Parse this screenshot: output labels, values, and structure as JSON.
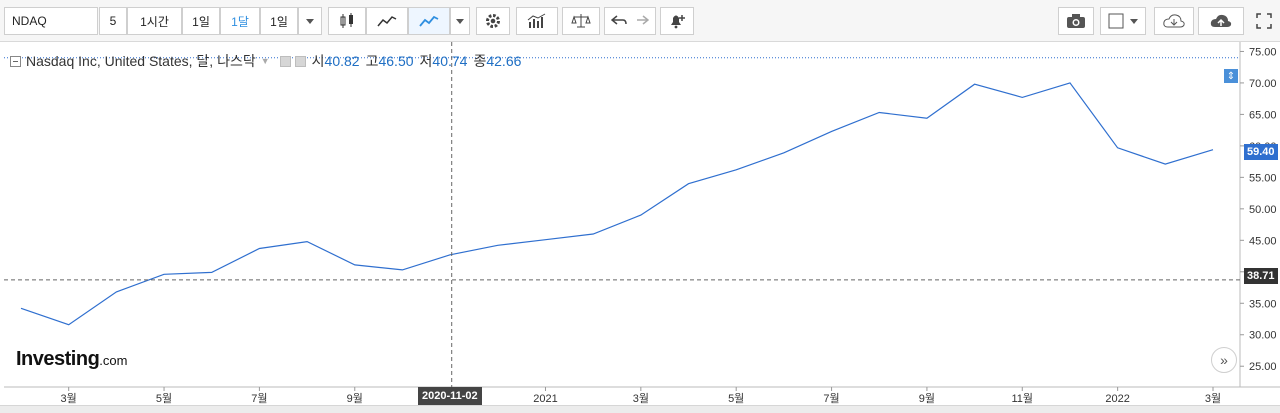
{
  "toolbar": {
    "symbol": "NDAQ",
    "intervals": [
      "5",
      "1시간",
      "1일",
      "1달",
      "1일"
    ],
    "active_interval": "1달"
  },
  "legend": {
    "title": "Nasdaq Inc, United States, 달, 나스닥",
    "open_label": "시",
    "open_value": "40.82",
    "high_label": "고",
    "high_value": "46.50",
    "low_label": "저",
    "low_value": "40.74",
    "close_label": "종",
    "close_value": "42.66"
  },
  "chart_data": {
    "type": "line",
    "x": [
      "2020-02",
      "2020-03",
      "2020-04",
      "2020-05",
      "2020-06",
      "2020-07",
      "2020-08",
      "2020-09",
      "2020-10",
      "2020-11",
      "2020-12",
      "2021-01",
      "2021-02",
      "2021-03",
      "2021-04",
      "2021-05",
      "2021-06",
      "2021-07",
      "2021-08",
      "2021-09",
      "2021-10",
      "2021-11",
      "2021-12",
      "2022-01",
      "2022-02",
      "2022-03"
    ],
    "series": [
      {
        "values": [
          34.2,
          31.6,
          36.8,
          39.6,
          39.9,
          43.7,
          44.8,
          41.1,
          40.3,
          42.7,
          44.2,
          45.1,
          46.0,
          49.0,
          54.0,
          56.2,
          58.9,
          62.3,
          65.3,
          64.4,
          69.8,
          67.7,
          70.0,
          59.7,
          57.1,
          59.4
        ]
      }
    ],
    "y_ticks": [
      "75.00",
      "70.00",
      "65.00",
      "60.00",
      "55.00",
      "50.00",
      "45.00",
      "40.00",
      "35.00",
      "30.00",
      "25.00"
    ],
    "ylim": [
      21.7,
      76.5
    ],
    "x_tick_labels": [
      {
        "label": "3월",
        "at": "2020-03"
      },
      {
        "label": "5월",
        "at": "2020-05"
      },
      {
        "label": "7월",
        "at": "2020-07"
      },
      {
        "label": "9월",
        "at": "2020-09"
      },
      {
        "label": "2021",
        "at": "2021-01"
      },
      {
        "label": "3월",
        "at": "2021-03"
      },
      {
        "label": "5월",
        "at": "2021-05"
      },
      {
        "label": "7월",
        "at": "2021-07"
      },
      {
        "label": "9월",
        "at": "2021-09"
      },
      {
        "label": "11월",
        "at": "2021-11"
      },
      {
        "label": "2022",
        "at": "2022-01"
      },
      {
        "label": "3월",
        "at": "2022-03"
      }
    ],
    "last_price": "59.40",
    "crosshair_price": "38.71",
    "crosshair_date": "2020-11-02",
    "high_reference": 74.0,
    "line_color": "#2f6fcf"
  },
  "logo": {
    "main": "Investing",
    "suffix": ".com"
  },
  "icons": {
    "scroll": "double-chevron-right-icon",
    "camera": "camera-icon",
    "settings": "gear-icon"
  }
}
